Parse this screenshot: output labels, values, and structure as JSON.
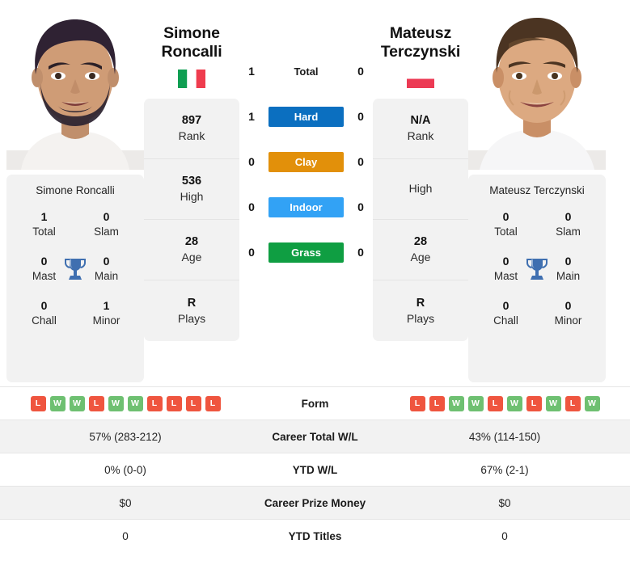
{
  "colors": {
    "hard": "#0b6fc0",
    "clay": "#e2900a",
    "indoor": "#32a2f5",
    "grass": "#0f9e42",
    "win": "#6ec071",
    "loss": "#ef553f",
    "trophy": "#3f6fb0",
    "card_bg": "#f2f2f2"
  },
  "left_player": {
    "first_name": "Simone",
    "last_name": "Roncalli",
    "full_name": "Simone Roncalli",
    "flag": "italy-flag",
    "photo": "player-photo-simone-roncalli",
    "stats": [
      {
        "value": "897",
        "label": "Rank"
      },
      {
        "value": "536",
        "label": "High"
      },
      {
        "value": "28",
        "label": "Age"
      },
      {
        "value": "R",
        "label": "Plays"
      }
    ],
    "titles": [
      {
        "value": "1",
        "label": "Total"
      },
      {
        "value": "0",
        "label": "Slam"
      },
      {
        "value": "0",
        "label": "Mast"
      },
      {
        "value": "0",
        "label": "Main"
      },
      {
        "value": "0",
        "label": "Chall"
      },
      {
        "value": "1",
        "label": "Minor"
      }
    ],
    "form": [
      "L",
      "W",
      "W",
      "L",
      "W",
      "W",
      "L",
      "L",
      "L",
      "L"
    ],
    "career_total_wl": "57% (283-212)",
    "ytd_wl": "0% (0-0)",
    "career_prize_money": "$0",
    "ytd_titles": "0"
  },
  "right_player": {
    "first_name": "Mateusz",
    "last_name": "Terczynski",
    "full_name": "Mateusz Terczynski",
    "flag": "poland-flag",
    "photo": "player-photo-mateusz-terczynski",
    "stats": [
      {
        "value": "N/A",
        "label": "Rank"
      },
      {
        "value": "",
        "label": "High"
      },
      {
        "value": "28",
        "label": "Age"
      },
      {
        "value": "R",
        "label": "Plays"
      }
    ],
    "titles": [
      {
        "value": "0",
        "label": "Total"
      },
      {
        "value": "0",
        "label": "Slam"
      },
      {
        "value": "0",
        "label": "Mast"
      },
      {
        "value": "0",
        "label": "Main"
      },
      {
        "value": "0",
        "label": "Chall"
      },
      {
        "value": "0",
        "label": "Minor"
      }
    ],
    "form": [
      "L",
      "L",
      "W",
      "W",
      "L",
      "W",
      "L",
      "W",
      "L",
      "W"
    ],
    "career_total_wl": "43% (114-150)",
    "ytd_wl": "67% (2-1)",
    "career_prize_money": "$0",
    "ytd_titles": "0"
  },
  "head_to_head": [
    {
      "label": "Total",
      "left": "1",
      "right": "0",
      "style": "plain"
    },
    {
      "label": "Hard",
      "left": "1",
      "right": "0",
      "style": "hard"
    },
    {
      "label": "Clay",
      "left": "0",
      "right": "0",
      "style": "clay"
    },
    {
      "label": "Indoor",
      "left": "0",
      "right": "0",
      "style": "indoor"
    },
    {
      "label": "Grass",
      "left": "0",
      "right": "0",
      "style": "grass"
    }
  ],
  "table": {
    "rows": [
      {
        "label": "Form",
        "type": "form"
      },
      {
        "label": "Career Total W/L",
        "type": "text",
        "key": "career_total_wl"
      },
      {
        "label": "YTD W/L",
        "type": "text",
        "key": "ytd_wl"
      },
      {
        "label": "Career Prize Money",
        "type": "text",
        "key": "career_prize_money"
      },
      {
        "label": "YTD Titles",
        "type": "text",
        "key": "ytd_titles"
      }
    ]
  }
}
